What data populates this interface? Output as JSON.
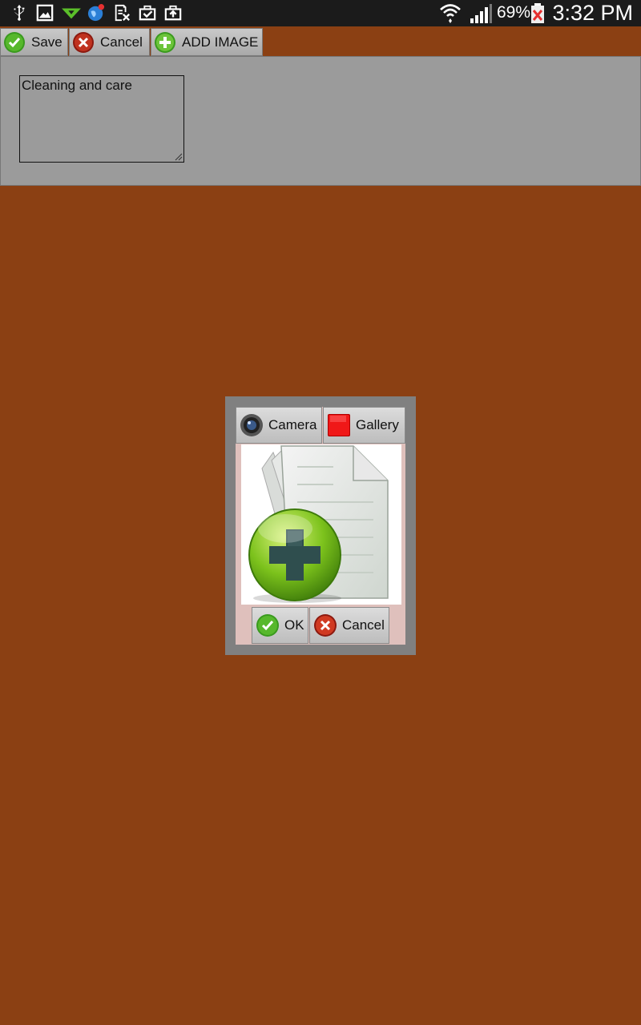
{
  "status_bar": {
    "battery": "69%",
    "time": "3:32 PM",
    "icons": [
      "usb-icon",
      "image-icon",
      "download-icon",
      "globe-notification-icon",
      "document-x-icon",
      "briefcase-check-icon",
      "briefcase-upload-icon",
      "wifi-icon",
      "signal-icon",
      "battery-icon"
    ]
  },
  "toolbar": {
    "save_label": "Save",
    "cancel_label": "Cancel",
    "add_image_label": "ADD IMAGE"
  },
  "form": {
    "description_value": "Cleaning and care"
  },
  "dialog": {
    "camera_label": "Camera",
    "gallery_label": "Gallery",
    "ok_label": "OK",
    "cancel_label": "Cancel",
    "preview_icon": "add-document-icon"
  },
  "colors": {
    "background": "#8B4013",
    "panel": "#9b9b9b",
    "status_bar": "#1b1b1b",
    "dialog_frame": "#808080",
    "dialog_inner": "#dfc0bc"
  }
}
